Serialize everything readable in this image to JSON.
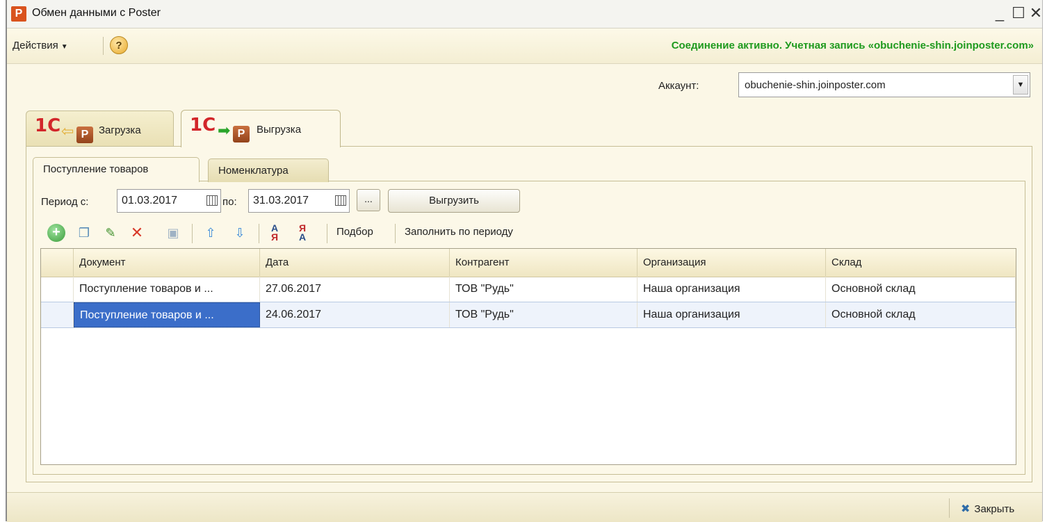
{
  "window": {
    "title": "Обмен данными с Poster",
    "logo_letter": "P",
    "minimize": "_",
    "maximize": "☐",
    "close": "✕"
  },
  "command_bar": {
    "actions_label": "Действия",
    "help_label": "?",
    "status": "Соединение активно. Учетная запись «obuchenie-shin.joinposter.com»",
    "status_color": "#1e9a1e"
  },
  "account": {
    "label": "Аккаунт:",
    "value": "obuchenie-shin.joinposter.com"
  },
  "tabs": [
    {
      "label": "Загрузка",
      "logo": "1С",
      "arrow": "⇦",
      "badge": "P",
      "active": false
    },
    {
      "label": "Выгрузка",
      "logo": "1С",
      "arrow": "➡",
      "badge": "P",
      "active": true
    }
  ],
  "subtabs": [
    {
      "label": "Поступление товаров",
      "active": true
    },
    {
      "label": "Номенклатура",
      "active": false
    }
  ],
  "period": {
    "from_label": "Период с:",
    "from_value": "01.03.2017",
    "to_label": "по:",
    "to_value": "31.03.2017",
    "ellipsis": "...",
    "export_label": "Выгрузить"
  },
  "toolbar": {
    "icons": [
      "add-icon",
      "copy-icon",
      "edit-icon",
      "delete-icon",
      "save-icon",
      "move-up-icon",
      "move-down-icon",
      "sort-ascending-icon",
      "sort-descending-icon"
    ],
    "select_label": "Подбор",
    "fill_label": "Заполнить по периоду"
  },
  "table": {
    "columns": [
      "",
      "Документ",
      "Дата",
      "Контрагент",
      "Организация",
      "Склад"
    ],
    "rows": [
      [
        "",
        "Поступление товаров и ...",
        "27.06.2017",
        "ТОВ \"Рудь\"",
        "Наша организация",
        "Основной склад"
      ],
      [
        "",
        "Поступление товаров и ...",
        "24.06.2017",
        "ТОВ \"Рудь\"",
        "Наша организация",
        "Основной склад"
      ]
    ],
    "selected_row": 1
  },
  "bottom": {
    "close_label": "Закрыть"
  }
}
